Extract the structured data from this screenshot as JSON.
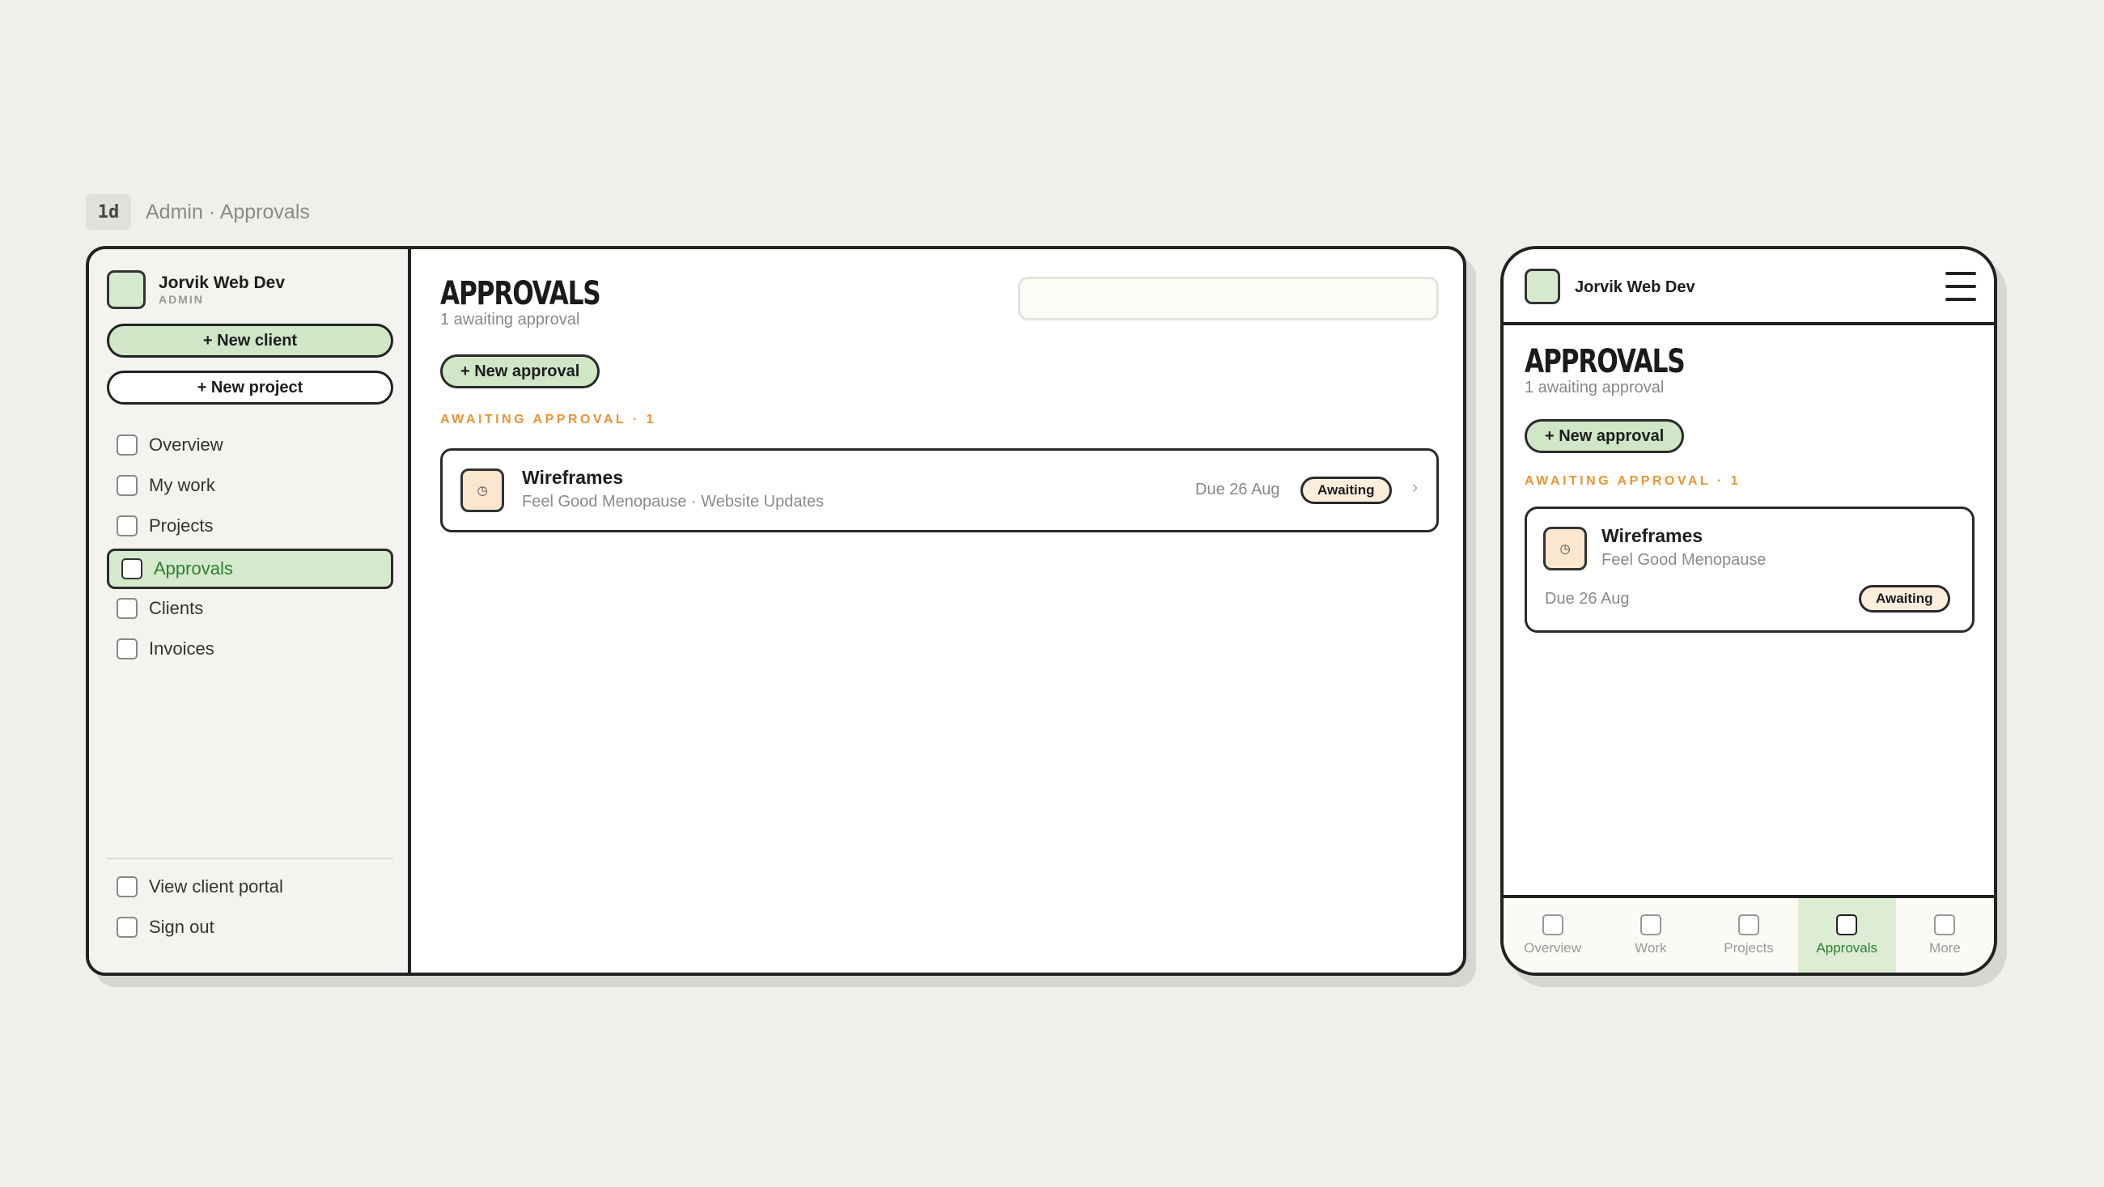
{
  "caption": {
    "tag": "1d",
    "breadcrumb": "Admin · Approvals"
  },
  "brand": {
    "name": "Jorvik Web Dev",
    "role": "ADMIN"
  },
  "sidebar": {
    "new_client": "+ New client",
    "new_project": "+ New project",
    "items": [
      {
        "label": "Overview",
        "active": false
      },
      {
        "label": "My work",
        "active": false
      },
      {
        "label": "Projects",
        "active": false
      },
      {
        "label": "Approvals",
        "active": true
      },
      {
        "label": "Clients",
        "active": false
      },
      {
        "label": "Invoices",
        "active": false
      }
    ],
    "footer": [
      {
        "label": "View client portal"
      },
      {
        "label": "Sign out"
      }
    ]
  },
  "page": {
    "title": "APPROVALS",
    "subtitle": "1 awaiting approval",
    "new_button": "+ New approval",
    "section": "AWAITING APPROVAL · 1",
    "search_placeholder": ""
  },
  "approval": {
    "icon": "clock-icon",
    "icon_glyph": "◷",
    "title": "Wireframes",
    "subtitle": "Feel Good Menopause · Website Updates",
    "subtitle_mobile": "Feel Good Menopause",
    "due": "Due 26 Aug",
    "status": "Awaiting",
    "chevron": "›"
  },
  "mobile_tabs": [
    {
      "label": "Overview",
      "active": false
    },
    {
      "label": "Work",
      "active": false
    },
    {
      "label": "Projects",
      "active": false
    },
    {
      "label": "Approvals",
      "active": true
    },
    {
      "label": "More",
      "active": false
    }
  ],
  "colors": {
    "accent_green": "#cfe7c7",
    "active_text": "#2e7d32",
    "section_orange": "#e89532",
    "badge_bg": "#fbeedd",
    "page_bg": "#f0efeb"
  }
}
